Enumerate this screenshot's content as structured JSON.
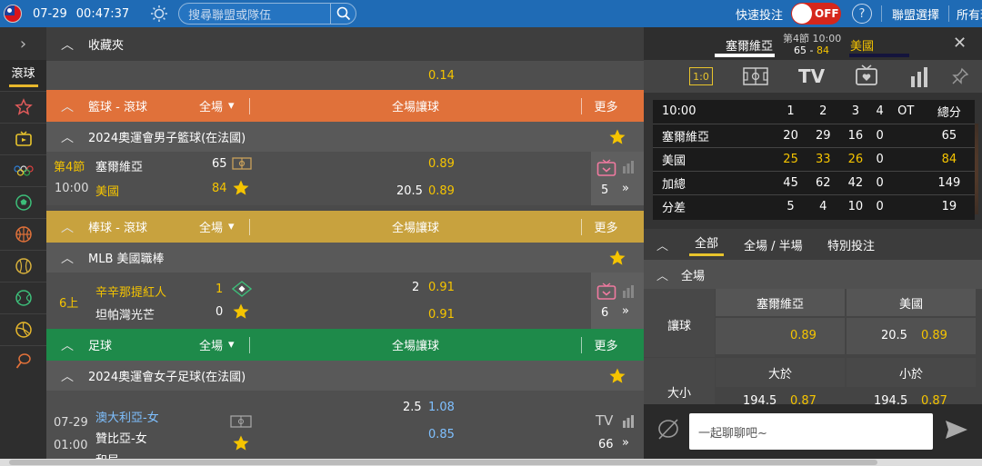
{
  "topbar": {
    "date": "07-29",
    "time": "00:47:37",
    "search_placeholder": "搜尋聯盟或隊伍",
    "quick_bet": "快速投注",
    "toggle": "OFF",
    "help": "?",
    "league_select": "聯盟選擇",
    "all": "所有球"
  },
  "sidebar": {
    "live": "滾球",
    "icons": [
      "star-icon",
      "tv-icon",
      "olympics-icon",
      "soccer-icon",
      "basketball-icon",
      "baseball-icon",
      "tennis-icon",
      "volleyball-icon",
      "badminton-icon"
    ]
  },
  "main": {
    "favorites": "收藏夾",
    "fav_odds": "0.14",
    "sections": [
      {
        "name": "籃球 - 滾球",
        "full": "全場",
        "mid": "全場讓球",
        "more": "更多",
        "league": "2024奧運會男子籃球(在法國)",
        "match": {
          "period": "第4節",
          "clock": "10:00",
          "home": "塞爾維亞",
          "away": "美國",
          "home_score": "65",
          "away_score": "84",
          "odds1": "0.89",
          "hcap": "20.5",
          "odds2": "0.89",
          "more_count": "5"
        }
      },
      {
        "name": "棒球 - 滾球",
        "full": "全場",
        "mid": "全場讓球",
        "more": "更多",
        "league": "MLB 美國職棒",
        "match": {
          "period": "6上",
          "home": "辛辛那提紅人",
          "away": "坦帕灣光芒",
          "home_score": "1",
          "away_score": "0",
          "hcap": "2",
          "odds1": "0.91",
          "odds2": "0.91",
          "more_count": "6"
        }
      },
      {
        "name": "足球",
        "full": "全場",
        "mid": "全場讓球",
        "more": "更多",
        "league": "2024奧運會女子足球(在法國)",
        "match": {
          "date": "07-29",
          "time": "01:00",
          "home": "澳大利亞-女",
          "away": "贊比亞-女",
          "draw": "和局",
          "hcap": "2.5",
          "odds1": "1.08",
          "odds2": "0.85",
          "tv": "TV",
          "more_count": "66"
        }
      }
    ]
  },
  "right": {
    "home": "塞爾維亞",
    "away": "美國",
    "period": "第4節 10:00",
    "score_home": "65",
    "score_dash": " - ",
    "score_away": "84",
    "tabs": [
      "1:0",
      "field",
      "TV",
      "tv-live",
      "stats",
      "pin"
    ],
    "table": {
      "header": [
        "10:00",
        "1",
        "2",
        "3",
        "4",
        "OT",
        "總分"
      ],
      "rows": [
        [
          "塞爾維亞",
          "20",
          "29",
          "16",
          "0",
          "",
          "65"
        ],
        [
          "美國",
          "25",
          "33",
          "26",
          "0",
          "",
          "84"
        ],
        [
          "加總",
          "45",
          "62",
          "42",
          "0",
          "",
          "149"
        ],
        [
          "分差",
          "5",
          "4",
          "10",
          "0",
          "",
          "19"
        ]
      ]
    },
    "bet_tabs": [
      "全部",
      "全場 / 半場",
      "特別投注"
    ],
    "full_match": "全場",
    "handicap_label": "讓球",
    "home_col": "塞爾維亞",
    "away_col": "美國",
    "h_odds1": "0.89",
    "h_line": "20.5",
    "h_odds2": "0.89",
    "ou_label": "大小",
    "over": "大於",
    "under": "小於",
    "ou_line1": "194.5",
    "ou_odds1": "0.87",
    "ou_line2": "194.5",
    "ou_odds2": "0.87",
    "chat_placeholder": "一起聊聊吧~"
  }
}
